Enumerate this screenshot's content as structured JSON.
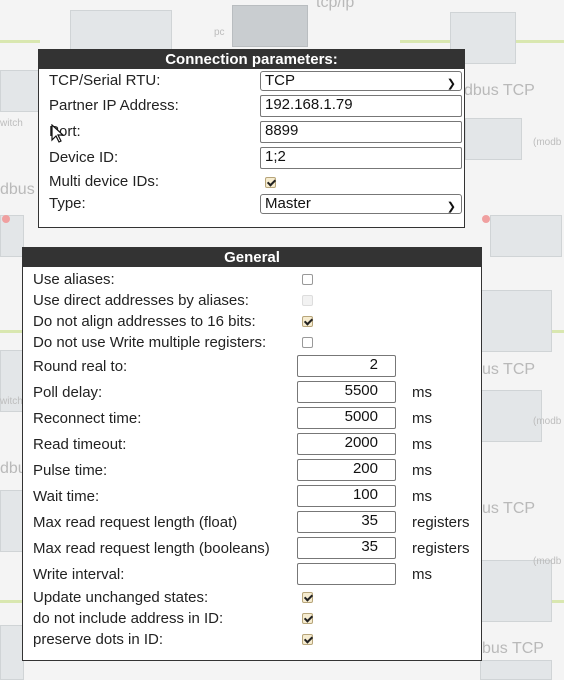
{
  "background": {
    "labels": [
      "tcp/ip",
      "pc",
      "dbus TCP",
      "(modb",
      "dbus",
      "witch",
      "us TCP",
      "(modb",
      "dbus",
      "witch",
      "us TCP",
      "(modb",
      "bus TCP"
    ]
  },
  "connection": {
    "title": "Connection parameters:",
    "fields": [
      {
        "label": "TCP/Serial RTU:",
        "kind": "select",
        "value": "TCP"
      },
      {
        "label": "Partner IP Address:",
        "kind": "text",
        "value": "192.168.1.79"
      },
      {
        "label": "Port:",
        "kind": "text",
        "value": "8899"
      },
      {
        "label": "Device ID:",
        "kind": "text",
        "value": "1;2"
      },
      {
        "label": "Multi device IDs:",
        "kind": "checkbox",
        "checked": true
      },
      {
        "label": "Type:",
        "kind": "select",
        "value": "Master"
      }
    ]
  },
  "general": {
    "title": "General",
    "fields": [
      {
        "label": "Use aliases:",
        "kind": "checkbox",
        "checked": false
      },
      {
        "label": "Use direct addresses by aliases:",
        "kind": "checkbox",
        "checked": false,
        "disabled": true
      },
      {
        "label": "Do not align addresses to 16 bits:",
        "kind": "checkbox",
        "checked": true
      },
      {
        "label": "Do not use Write multiple registers:",
        "kind": "checkbox",
        "checked": false
      },
      {
        "label": "Round real to:",
        "kind": "number",
        "value": "2",
        "unit": ""
      },
      {
        "label": "Poll delay:",
        "kind": "number",
        "value": "5500",
        "unit": "ms"
      },
      {
        "label": "Reconnect time:",
        "kind": "number",
        "value": "5000",
        "unit": "ms"
      },
      {
        "label": "Read timeout:",
        "kind": "number",
        "value": "2000",
        "unit": "ms"
      },
      {
        "label": "Pulse time:",
        "kind": "number",
        "value": "200",
        "unit": "ms"
      },
      {
        "label": "Wait time:",
        "kind": "number",
        "value": "100",
        "unit": "ms"
      },
      {
        "label": "Max read request length (float)",
        "kind": "number",
        "value": "35",
        "unit": "registers"
      },
      {
        "label": "Max read request length (booleans)",
        "kind": "number",
        "value": "35",
        "unit": "registers"
      },
      {
        "label": "Write interval:",
        "kind": "number",
        "value": "",
        "unit": "ms"
      },
      {
        "label": "Update unchanged states:",
        "kind": "checkbox",
        "checked": true
      },
      {
        "label": "do not include address in ID:",
        "kind": "checkbox",
        "checked": true
      },
      {
        "label": "preserve dots in ID:",
        "kind": "checkbox",
        "checked": true
      }
    ]
  }
}
